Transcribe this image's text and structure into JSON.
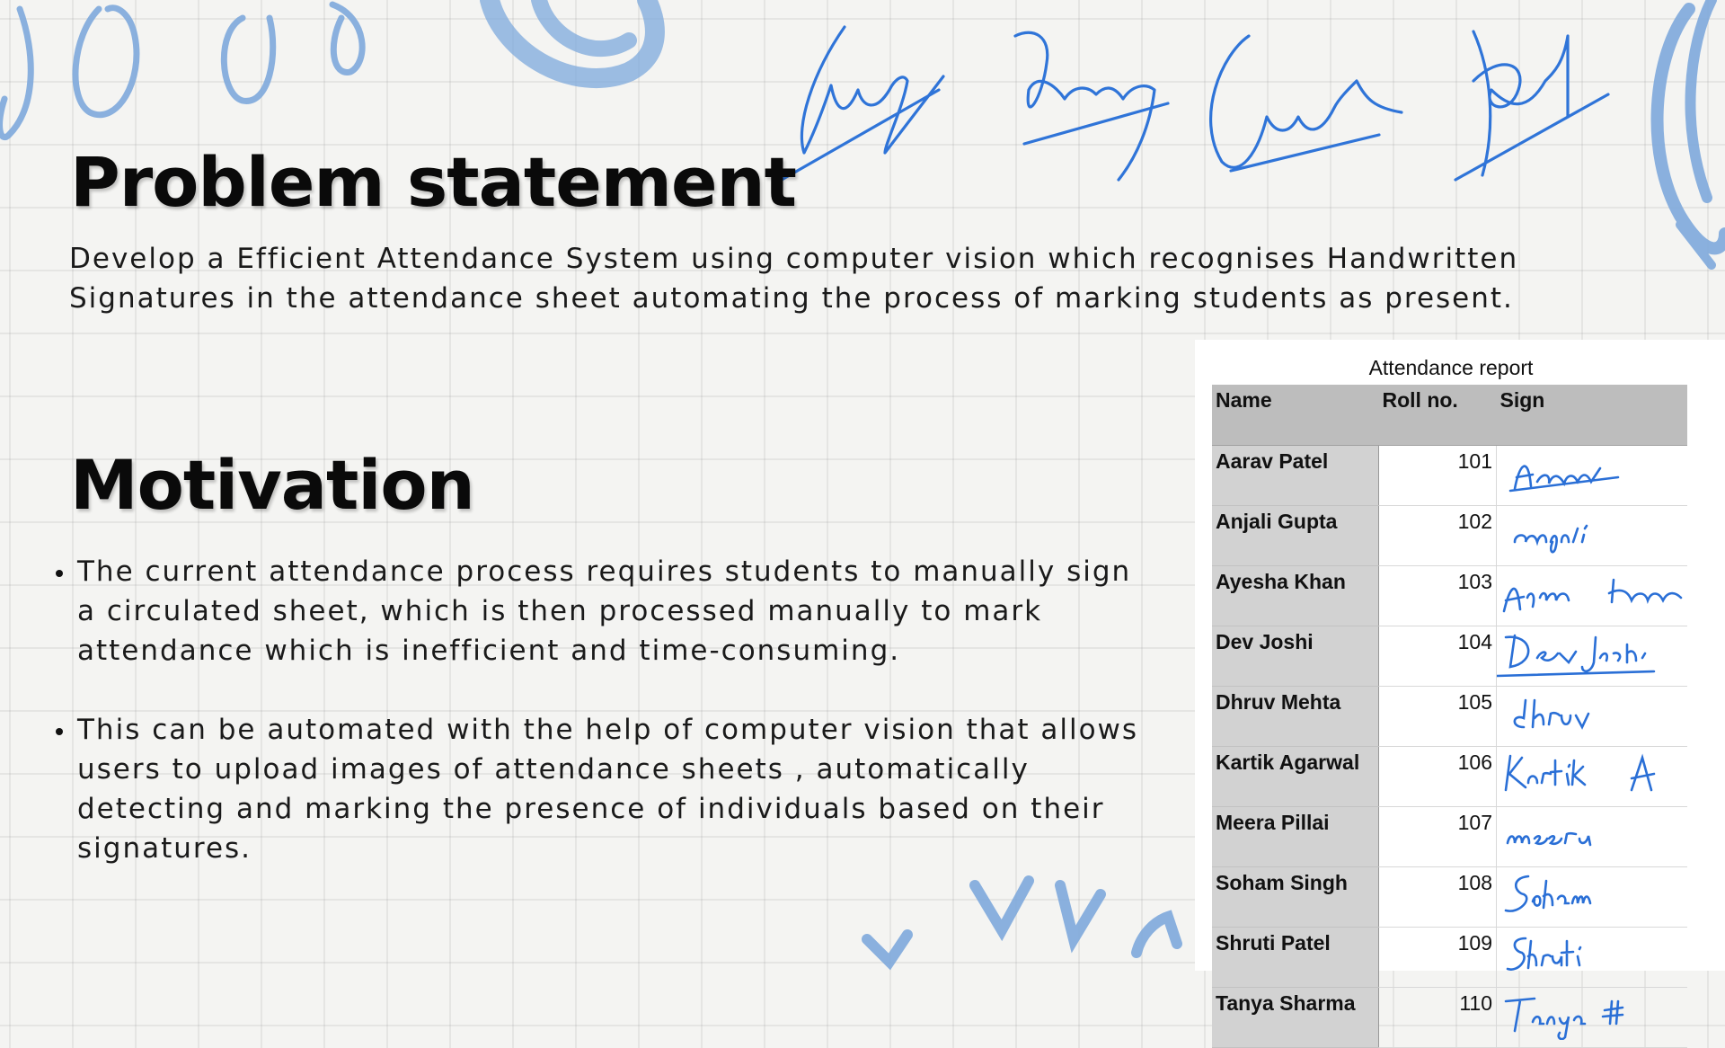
{
  "headings": {
    "problem": "Problem statement",
    "motivation": "Motivation"
  },
  "problem_text": "Develop a Efficient Attendance System using computer vision which recognises Handwritten Signatures in the attendance sheet automating the process of marking students as present.",
  "motivation_points": [
    "The current attendance process requires students to manually sign a circulated sheet, which is then processed manually to mark attendance which is inefficient and time-consuming.",
    "This can be automated with the help of computer vision that allows users to upload images of attendance sheets , automatically detecting and marking the presence of individuals based on their signatures."
  ],
  "report": {
    "title": "Attendance report",
    "headers": [
      "Name",
      "Roll no.",
      "Sign"
    ],
    "rows": [
      {
        "name": "Aarav Patel",
        "roll": "101",
        "sign": "Aarav"
      },
      {
        "name": "Anjali Gupta",
        "roll": "102",
        "sign": "anjali"
      },
      {
        "name": "Ayesha Khan",
        "roll": "103",
        "sign": "Ayesha Khan"
      },
      {
        "name": "Dev Joshi",
        "roll": "104",
        "sign": "Dev Joshi"
      },
      {
        "name": "Dhruv Mehta",
        "roll": "105",
        "sign": "dhruv"
      },
      {
        "name": "Kartik Agarwal",
        "roll": "106",
        "sign": "Kartik A"
      },
      {
        "name": "Meera Pillai",
        "roll": "107",
        "sign": "meera"
      },
      {
        "name": "Soham Singh",
        "roll": "108",
        "sign": "Soham"
      },
      {
        "name": "Shruti Patel",
        "roll": "109",
        "sign": "Shruti"
      },
      {
        "name": "Tanya Sharma",
        "roll": "110",
        "sign": "Tanya"
      }
    ]
  },
  "colors": {
    "accent_blue": "#6f9fd8",
    "ink_blue": "#2a6fd6",
    "header_gray": "#bdbdbd",
    "name_column_gray": "#d2d2d2"
  }
}
